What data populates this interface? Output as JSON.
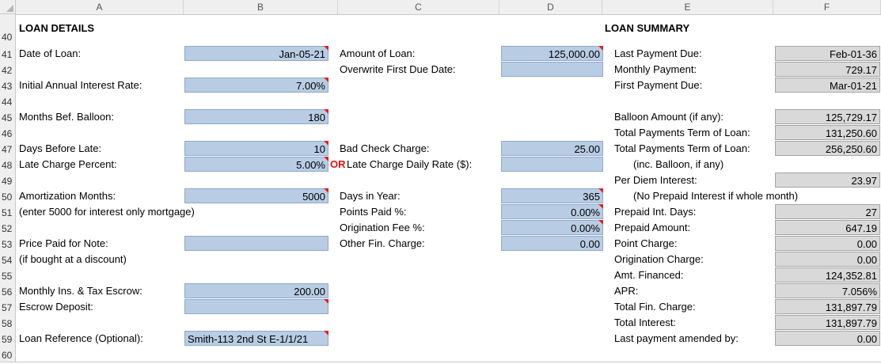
{
  "columns": [
    "A",
    "B",
    "C",
    "D",
    "E",
    "F"
  ],
  "rows": [
    "40",
    "41",
    "42",
    "43",
    "44",
    "45",
    "46",
    "47",
    "48",
    "49",
    "50",
    "51",
    "52",
    "53",
    "54",
    "55",
    "56",
    "57",
    "58",
    "59",
    "60"
  ],
  "loan_details": {
    "title": "LOAN DETAILS",
    "date_of_loan_label": "Date of Loan:",
    "date_of_loan": "Jan-05-21",
    "initial_rate_label": "Initial Annual Interest Rate:",
    "initial_rate": "7.00%",
    "months_balloon_label": "Months Bef. Balloon:",
    "months_balloon": "180",
    "days_before_late_label": "Days Before Late:",
    "days_before_late": "10",
    "late_charge_percent_label": "Late Charge Percent:",
    "late_charge_percent": "5.00%",
    "amort_months_label": "Amortization Months:",
    "amort_months": "5000",
    "amort_note": "(enter 5000 for interest only mortgage)",
    "price_paid_label": "Price Paid for Note:",
    "price_paid": "",
    "price_paid_note": "(if bought at a discount)",
    "monthly_escrow_label": "Monthly Ins. & Tax Escrow:",
    "monthly_escrow": "200.00",
    "escrow_deposit_label": "Escrow Deposit:",
    "escrow_deposit": "",
    "loan_ref_label": "Loan Reference (Optional):",
    "loan_ref": "Smith-113 2nd St E-1/1/21"
  },
  "middle": {
    "amount_label": "Amount of Loan:",
    "amount": "125,000.00",
    "overwrite_label": "Overwrite First Due Date:",
    "overwrite": "",
    "bad_check_label": "Bad Check Charge:",
    "bad_check": "25.00",
    "or_text": "OR",
    "late_daily_label": "Late Charge Daily Rate ($):",
    "late_daily": "",
    "days_year_label": "Days in Year:",
    "days_year": "365",
    "points_label": "Points Paid %:",
    "points": "0.00%",
    "orig_fee_label": "Origination Fee %:",
    "orig_fee": "0.00%",
    "other_fin_label": "Other Fin. Charge:",
    "other_fin": "0.00"
  },
  "summary": {
    "title": "LOAN SUMMARY",
    "last_due_label": "Last Payment Due:",
    "last_due": "Feb-01-36",
    "monthly_payment_label": "Monthly Payment:",
    "monthly_payment": "729.17",
    "first_due_label": "First Payment Due:",
    "first_due": "Mar-01-21",
    "balloon_label": "Balloon Amount (if any):",
    "balloon": "125,729.17",
    "total_term_label": "Total Payments Term of Loan:",
    "total_term": "131,250.60",
    "total_term2_label": "Total Payments Term of Loan:",
    "total_term2": "256,250.60",
    "inc_balloon_note": "(inc. Balloon, if any)",
    "per_diem_label": "Per Diem Interest:",
    "per_diem": "23.97",
    "no_prepaid_note": "(No Prepaid Interest if whole month)",
    "prepaid_days_label": "Prepaid Int. Days:",
    "prepaid_days": "27",
    "prepaid_amount_label": "Prepaid Amount:",
    "prepaid_amount": "647.19",
    "point_charge_label": "Point Charge:",
    "point_charge": "0.00",
    "orig_charge_label": "Origination Charge:",
    "orig_charge": "0.00",
    "amt_financed_label": "Amt. Financed:",
    "amt_financed": "124,352.81",
    "apr_label": "APR:",
    "apr": "7.056%",
    "total_fin_label": "Total Fin. Charge:",
    "total_fin": "131,897.79",
    "total_interest_label": "Total Interest:",
    "total_interest": "131,897.79",
    "last_amended_label": "Last payment amended by:",
    "last_amended": "0.00"
  }
}
